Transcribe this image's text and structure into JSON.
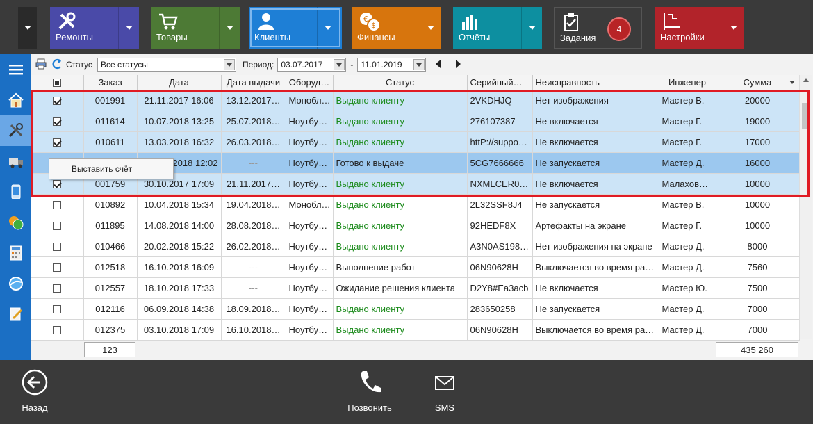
{
  "toolbar": {
    "tiles": [
      {
        "label": "Ремонты",
        "icon": "tools-icon"
      },
      {
        "label": "Товары",
        "icon": "cart-icon"
      },
      {
        "label": "Клиенты",
        "icon": "user-icon"
      },
      {
        "label": "Финансы",
        "icon": "coins-icon"
      },
      {
        "label": "Отчёты",
        "icon": "bar-chart-icon"
      },
      {
        "label": "Задания",
        "icon": "clipboard-icon",
        "badge": "4"
      },
      {
        "label": "Настройки",
        "icon": "settings-icon"
      }
    ],
    "colors": {
      "repairs": "#4a4aa8",
      "goods": "#4d7a35",
      "clients": "#1e7fd6",
      "finance": "#d7750d",
      "reports": "#0d8fa0",
      "tasks": "#3b3b3b",
      "settings": "#b2232a"
    }
  },
  "filters": {
    "status_label": "Статус",
    "status_value": "Все статусы",
    "period_label": "Период:",
    "date_from": "03.07.2017",
    "separator": "-",
    "date_to": "11.01.2019"
  },
  "table": {
    "columns": [
      "Заказ",
      "Дата",
      "Дата выдачи",
      "Оборуд…",
      "Статус",
      "Серийный…",
      "Неисправность",
      "Инженер",
      "Сумма"
    ],
    "rows": [
      {
        "checked": true,
        "order": "001991",
        "date": "21.11.2017 16:06",
        "issued": "13.12.2017…",
        "equip": "Монобл…",
        "status": "Выдано клиенту",
        "serial": "2VKDHJQ",
        "fault": "Нет изображения",
        "engineer": "Мастер В.",
        "sum": "20000"
      },
      {
        "checked": true,
        "order": "011614",
        "date": "10.07.2018 13:25",
        "issued": "25.07.2018…",
        "equip": "Ноутбу…",
        "status": "Выдано клиенту",
        "serial": "276107387",
        "fault": "Не включается",
        "engineer": "Мастер Г.",
        "sum": "19000"
      },
      {
        "checked": true,
        "order": "010611",
        "date": "13.03.2018 16:32",
        "issued": "26.03.2018…",
        "equip": "Ноутбу…",
        "status": "Выдано клиенту",
        "serial": "httP://suppo…",
        "fault": "Не включается",
        "engineer": "Мастер Г.",
        "sum": "17000"
      },
      {
        "checked": true,
        "order": "",
        "date": "2018 12:02",
        "issued": "---",
        "equip": "Ноутбу…",
        "status": "Готово к выдаче",
        "serial": "5CG7666666",
        "fault": "Не запускается",
        "engineer": "Мастер Д.",
        "sum": "16000"
      },
      {
        "checked": true,
        "order": "001759",
        "date": "30.10.2017 17:09",
        "issued": "21.11.2017…",
        "equip": "Ноутбу…",
        "status": "Выдано клиенту",
        "serial": "NXMLCER0…",
        "fault": "Не включается",
        "engineer": "Малахов…",
        "sum": "10000"
      },
      {
        "checked": false,
        "order": "010892",
        "date": "10.04.2018 15:34",
        "issued": "19.04.2018…",
        "equip": "Монобл…",
        "status": "Выдано клиенту",
        "serial": "2L32SSF8J4",
        "fault": "Не запускается",
        "engineer": "Мастер В.",
        "sum": "10000"
      },
      {
        "checked": false,
        "order": "011895",
        "date": "14.08.2018 14:00",
        "issued": "28.08.2018…",
        "equip": "Ноутбу…",
        "status": "Выдано клиенту",
        "serial": "92HEDF8X",
        "fault": "Артефакты на экране",
        "engineer": "Мастер Г.",
        "sum": "10000"
      },
      {
        "checked": false,
        "order": "010466",
        "date": "20.02.2018 15:22",
        "issued": "26.02.2018…",
        "equip": "Ноутбу…",
        "status": "Выдано клиенту",
        "serial": "A3N0AS198…",
        "fault": "Нет изображения на экране",
        "engineer": "Мастер Д.",
        "sum": "8000"
      },
      {
        "checked": false,
        "order": "012518",
        "date": "16.10.2018 16:09",
        "issued": "---",
        "equip": "Ноутбу…",
        "status": "Выполнение работ",
        "serial": "06N90628H",
        "fault": "Выключается во время ра…",
        "engineer": "Мастер Д.",
        "sum": "7560"
      },
      {
        "checked": false,
        "order": "012557",
        "date": "18.10.2018 17:33",
        "issued": "---",
        "equip": "Ноутбу…",
        "status": "Ожидание решения клиента",
        "serial": "D2Y8#Ea3acb",
        "fault": "Не включается",
        "engineer": "Мастер Ю.",
        "sum": "7500"
      },
      {
        "checked": false,
        "order": "012116",
        "date": "06.09.2018 14:38",
        "issued": "18.09.2018…",
        "equip": "Ноутбу…",
        "status": "Выдано клиенту",
        "serial": "283650258",
        "fault": "Не запускается",
        "engineer": "Мастер Д.",
        "sum": "7000"
      },
      {
        "checked": false,
        "order": "012375",
        "date": "03.10.2018 17:09",
        "issued": "16.10.2018…",
        "equip": "Ноутбу…",
        "status": "Выдано клиенту",
        "serial": "06N90628H",
        "fault": "Выключается во время ра…",
        "engineer": "Мастер Д.",
        "sum": "7000"
      }
    ],
    "total_count": "123",
    "total_sum": "435 260"
  },
  "context_menu": {
    "item": "Выставить счёт"
  },
  "bottom": {
    "back": "Назад",
    "call": "Позвонить",
    "sms": "SMS"
  }
}
